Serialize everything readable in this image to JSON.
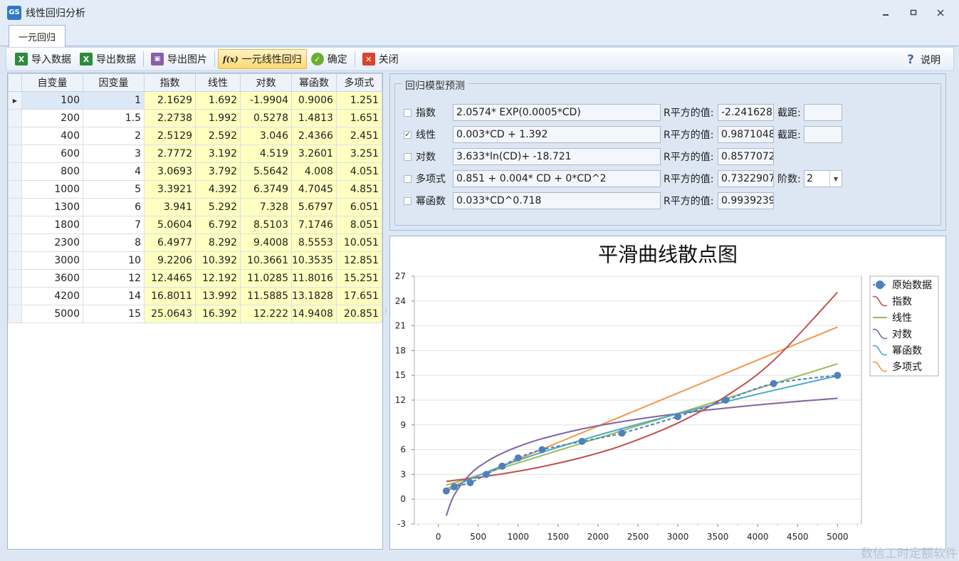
{
  "window": {
    "logo": "GS",
    "title": "线性回归分析"
  },
  "tabs": [
    {
      "label": "一元回归"
    }
  ],
  "toolbar": {
    "import_label": "导入数据",
    "export_label": "导出数据",
    "export_img_label": "导出图片",
    "regress_label": "一元线性回归",
    "confirm_label": "确定",
    "close_label": "关闭",
    "help_label": "说明",
    "fx_icon_text": "f(x)"
  },
  "grid": {
    "headers": [
      "自变量",
      "因变量",
      "指数",
      "线性",
      "对数",
      "幂函数",
      "多项式"
    ],
    "rows": [
      [
        "100",
        "1",
        "2.1629",
        "1.692",
        "-1.9904",
        "0.9006",
        "1.251"
      ],
      [
        "200",
        "1.5",
        "2.2738",
        "1.992",
        "0.5278",
        "1.4813",
        "1.651"
      ],
      [
        "400",
        "2",
        "2.5129",
        "2.592",
        "3.046",
        "2.4366",
        "2.451"
      ],
      [
        "600",
        "3",
        "2.7772",
        "3.192",
        "4.519",
        "3.2601",
        "3.251"
      ],
      [
        "800",
        "4",
        "3.0693",
        "3.792",
        "5.5642",
        "4.008",
        "4.051"
      ],
      [
        "1000",
        "5",
        "3.3921",
        "4.392",
        "6.3749",
        "4.7045",
        "4.851"
      ],
      [
        "1300",
        "6",
        "3.941",
        "5.292",
        "7.328",
        "5.6797",
        "6.051"
      ],
      [
        "1800",
        "7",
        "5.0604",
        "6.792",
        "8.5103",
        "7.1746",
        "8.051"
      ],
      [
        "2300",
        "8",
        "6.4977",
        "8.292",
        "9.4008",
        "8.5553",
        "10.051"
      ],
      [
        "3000",
        "10",
        "9.2206",
        "10.392",
        "10.3661",
        "10.3535",
        "12.851"
      ],
      [
        "3600",
        "12",
        "12.4465",
        "12.192",
        "11.0285",
        "11.8016",
        "15.251"
      ],
      [
        "4200",
        "14",
        "16.8011",
        "13.992",
        "11.5885",
        "13.1828",
        "17.651"
      ],
      [
        "5000",
        "15",
        "25.0643",
        "16.392",
        "12.222",
        "14.9408",
        "20.851"
      ]
    ]
  },
  "regression": {
    "title": "回归模型预测",
    "r2_label": "R平方的值:",
    "intercept_label": "截距:",
    "order_label": "阶数:",
    "order_value": "2",
    "rows": [
      {
        "label": "指数",
        "checked": false,
        "formula": "2.0574* EXP(0.0005*CD)",
        "r2": "-2.2416285",
        "has_intercept": true
      },
      {
        "label": "线性",
        "checked": true,
        "formula": "0.003*CD + 1.392",
        "r2": "0.9871048",
        "has_intercept": true
      },
      {
        "label": "对数",
        "checked": false,
        "formula": "3.633*ln(CD)+ -18.721",
        "r2": "0.8577072",
        "has_intercept": false
      },
      {
        "label": "多项式",
        "checked": false,
        "formula": "0.851 + 0.004* CD + 0*CD^2",
        "r2": "0.7322907",
        "has_order": true
      },
      {
        "label": "幂函数",
        "checked": false,
        "formula": "0.033*CD^0.718",
        "r2": "0.9939239",
        "has_intercept": false
      }
    ]
  },
  "chart_data": {
    "type": "line",
    "title": "平滑曲线散点图",
    "xlabel": "",
    "ylabel": "",
    "xlim": [
      -300,
      5300
    ],
    "ylim": [
      -3,
      27
    ],
    "xticks": [
      0,
      500,
      1000,
      1500,
      2000,
      2500,
      3000,
      3500,
      4000,
      4500,
      5000
    ],
    "yticks": [
      -3,
      0,
      3,
      6,
      9,
      12,
      15,
      18,
      21,
      24,
      27
    ],
    "grid": true,
    "legend_position": "top-right",
    "series": [
      {
        "name": "原始数据",
        "color": "#4f81bd",
        "style": "dashed-markers",
        "x": [
          100,
          200,
          400,
          600,
          800,
          1000,
          1300,
          1800,
          2300,
          3000,
          3600,
          4200,
          5000
        ],
        "y": [
          1,
          1.5,
          2,
          3,
          4,
          5,
          6,
          7,
          8,
          10,
          12,
          14,
          15
        ]
      },
      {
        "name": "指数",
        "color": "#c0504d",
        "style": "line",
        "x": [
          100,
          200,
          400,
          600,
          800,
          1000,
          1300,
          1800,
          2300,
          3000,
          3600,
          4200,
          5000
        ],
        "y": [
          2.1629,
          2.2738,
          2.5129,
          2.7772,
          3.0693,
          3.3921,
          3.941,
          5.0604,
          6.4977,
          9.2206,
          12.4465,
          16.8011,
          25.0643
        ]
      },
      {
        "name": "线性",
        "color": "#9bbb59",
        "style": "line",
        "x": [
          100,
          200,
          400,
          600,
          800,
          1000,
          1300,
          1800,
          2300,
          3000,
          3600,
          4200,
          5000
        ],
        "y": [
          1.692,
          1.992,
          2.592,
          3.192,
          3.792,
          4.392,
          5.292,
          6.792,
          8.292,
          10.392,
          12.192,
          13.992,
          16.392
        ]
      },
      {
        "name": "对数",
        "color": "#8064a2",
        "style": "line",
        "x": [
          100,
          200,
          400,
          600,
          800,
          1000,
          1300,
          1800,
          2300,
          3000,
          3600,
          4200,
          5000
        ],
        "y": [
          -1.9904,
          0.5278,
          3.046,
          4.519,
          5.5642,
          6.3749,
          7.328,
          8.5103,
          9.4008,
          10.3661,
          11.0285,
          11.5885,
          12.222
        ]
      },
      {
        "name": "幂函数",
        "color": "#4bacc6",
        "style": "line",
        "x": [
          100,
          200,
          400,
          600,
          800,
          1000,
          1300,
          1800,
          2300,
          3000,
          3600,
          4200,
          5000
        ],
        "y": [
          0.9006,
          1.4813,
          2.4366,
          3.2601,
          4.008,
          4.7045,
          5.6797,
          7.1746,
          8.5553,
          10.3535,
          11.8016,
          13.1828,
          14.9408
        ]
      },
      {
        "name": "多项式",
        "color": "#f79646",
        "style": "line",
        "x": [
          100,
          200,
          400,
          600,
          800,
          1000,
          1300,
          1800,
          2300,
          3000,
          3600,
          4200,
          5000
        ],
        "y": [
          1.251,
          1.651,
          2.451,
          3.251,
          4.051,
          4.851,
          6.051,
          8.051,
          10.051,
          12.851,
          15.251,
          17.651,
          20.851
        ]
      }
    ]
  }
}
